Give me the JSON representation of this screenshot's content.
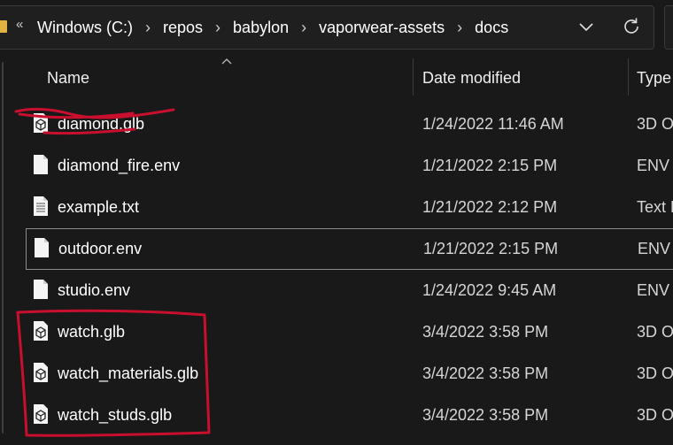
{
  "address_bar": {
    "overflow": "«",
    "crumbs": [
      "Windows (C:)",
      "repos",
      "babylon",
      "vaporwear-assets",
      "docs"
    ],
    "separator": "›"
  },
  "columns": {
    "name": "Name",
    "date": "Date modified",
    "type": "Type"
  },
  "files": [
    {
      "name": "diamond.glb",
      "date": "1/24/2022 11:46 AM",
      "type": "3D O",
      "icon": "3d-object-icon"
    },
    {
      "name": "diamond_fire.env",
      "date": "1/21/2022 2:15 PM",
      "type": "ENV F",
      "icon": "file-icon"
    },
    {
      "name": "example.txt",
      "date": "1/21/2022 2:12 PM",
      "type": "Text D",
      "icon": "text-file-icon"
    },
    {
      "name": "outdoor.env",
      "date": "1/21/2022 2:15 PM",
      "type": "ENV F",
      "icon": "file-icon"
    },
    {
      "name": "studio.env",
      "date": "1/24/2022 9:45 AM",
      "type": "ENV F",
      "icon": "file-icon"
    },
    {
      "name": "watch.glb",
      "date": "3/4/2022 3:58 PM",
      "type": "3D O",
      "icon": "3d-object-icon"
    },
    {
      "name": "watch_materials.glb",
      "date": "3/4/2022 3:58 PM",
      "type": "3D O",
      "icon": "3d-object-icon"
    },
    {
      "name": "watch_studs.glb",
      "date": "3/4/2022 3:58 PM",
      "type": "3D O",
      "icon": "3d-object-icon"
    }
  ],
  "colors": {
    "background": "#191919",
    "annotation": "#c8102e",
    "folder": "#e3b341"
  }
}
